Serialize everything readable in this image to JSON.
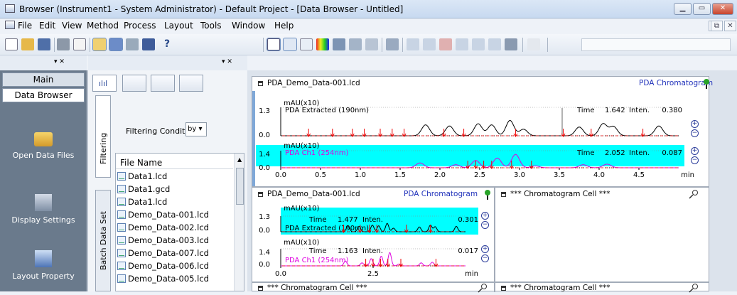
{
  "window": {
    "title": "Browser (Instrument1 - System Administrator) - Default Project - [Data Browser - Untitled]"
  },
  "menu": [
    "File",
    "Edit",
    "View",
    "Method",
    "Process",
    "Layout",
    "Tools",
    "Window",
    "Help"
  ],
  "toolbar": {
    "help": "?"
  },
  "left_nav": {
    "tabs": [
      "Main",
      "Data Browser"
    ],
    "items": [
      "Open Data Files",
      "Display Settings",
      "Layout Property"
    ]
  },
  "mid": {
    "side_tabs": [
      "Filtering",
      "Batch Data Set"
    ],
    "filter_label": "Filtering Condition:",
    "filter_value": "by",
    "list_header": "File Name",
    "files": [
      "Data1.lcd",
      "Data1.gcd",
      "Data1.lcd",
      "Demo_Data-001.lcd",
      "Demo_Data-002.lcd",
      "Demo_Data-003.lcd",
      "Demo_Data-007.lcd",
      "Demo_Data-006.lcd",
      "Demo_Data-005.lcd"
    ]
  },
  "main_cell": {
    "file": "PDA_Demo_Data-001.lcd",
    "mode": "PDA Chromatogram",
    "unit": "mAU(x10)",
    "trace1": {
      "name": "PDA Extracted (190nm)",
      "ymax": "1.3",
      "ymin": "0.0",
      "time_label": "Time",
      "time": "1.642",
      "inten_label": "Inten.",
      "inten": "0.380"
    },
    "trace2": {
      "name": "PDA Ch1 (254nm)",
      "ymax": "1.4",
      "ymin": "0.0",
      "time_label": "Time",
      "time": "2.052",
      "inten_label": "Inten.",
      "inten": "0.087"
    },
    "xticks": [
      "0.0",
      "0.5",
      "1.0",
      "1.5",
      "2.0",
      "2.5",
      "3.0",
      "3.5",
      "4.0",
      "4.5"
    ],
    "xunit": "min"
  },
  "small_cell": {
    "file": "PDA_Demo_Data-001.lcd",
    "mode": "PDA Chromatogram",
    "unit": "mAU(x10)",
    "trace1": {
      "name": "PDA Extracted (190nm)",
      "ymax": "1.3",
      "ymin": "0.0",
      "time_label": "Time",
      "time": "1.477",
      "inten_label": "Inten.",
      "inten": "0.301"
    },
    "trace2": {
      "name": "PDA Ch1 (254nm)",
      "ymax": "1.4",
      "ymin": "0.0",
      "time_label": "Time",
      "time": "1.163",
      "inten_label": "Inten.",
      "inten": "0.017"
    },
    "xticks": [
      "0.0",
      "2.5"
    ],
    "xunit": "min"
  },
  "empty_cell": "*** Chromatogram Cell ***",
  "colors": {
    "trace1": "#000000",
    "trace2": "#e000e0",
    "marker": "#ee0000",
    "highlight": "#00ffff",
    "nav_bg": "#6a7a8c"
  },
  "chart_data": [
    {
      "type": "line",
      "title": "PDA Extracted (190nm)",
      "ylabel": "mAU(x10)",
      "xlabel": "min",
      "ylim": [
        0,
        1.3
      ],
      "xlim": [
        0,
        5.0
      ],
      "series": [
        {
          "name": "PDA Extracted (190nm)",
          "x": [
            1.82,
            2.12,
            2.48,
            2.65,
            2.88,
            3.05,
            3.75,
            4.05,
            4.18,
            4.75
          ],
          "y": [
            0.5,
            0.45,
            0.55,
            0.5,
            0.7,
            0.3,
            0.4,
            0.55,
            0.42,
            0.45
          ]
        }
      ]
    },
    {
      "type": "line",
      "title": "PDA Ch1 (254nm)",
      "ylabel": "mAU(x10)",
      "xlabel": "min",
      "ylim": [
        0,
        1.4
      ],
      "xlim": [
        0,
        5.0
      ],
      "series": [
        {
          "name": "PDA Ch1 (254nm)",
          "x": [
            1.75,
            2.2,
            2.45,
            2.72,
            2.95,
            3.2,
            3.8,
            4.1
          ],
          "y": [
            0.4,
            0.25,
            0.6,
            0.8,
            1.1,
            0.15,
            0.25,
            0.3
          ]
        }
      ]
    }
  ]
}
